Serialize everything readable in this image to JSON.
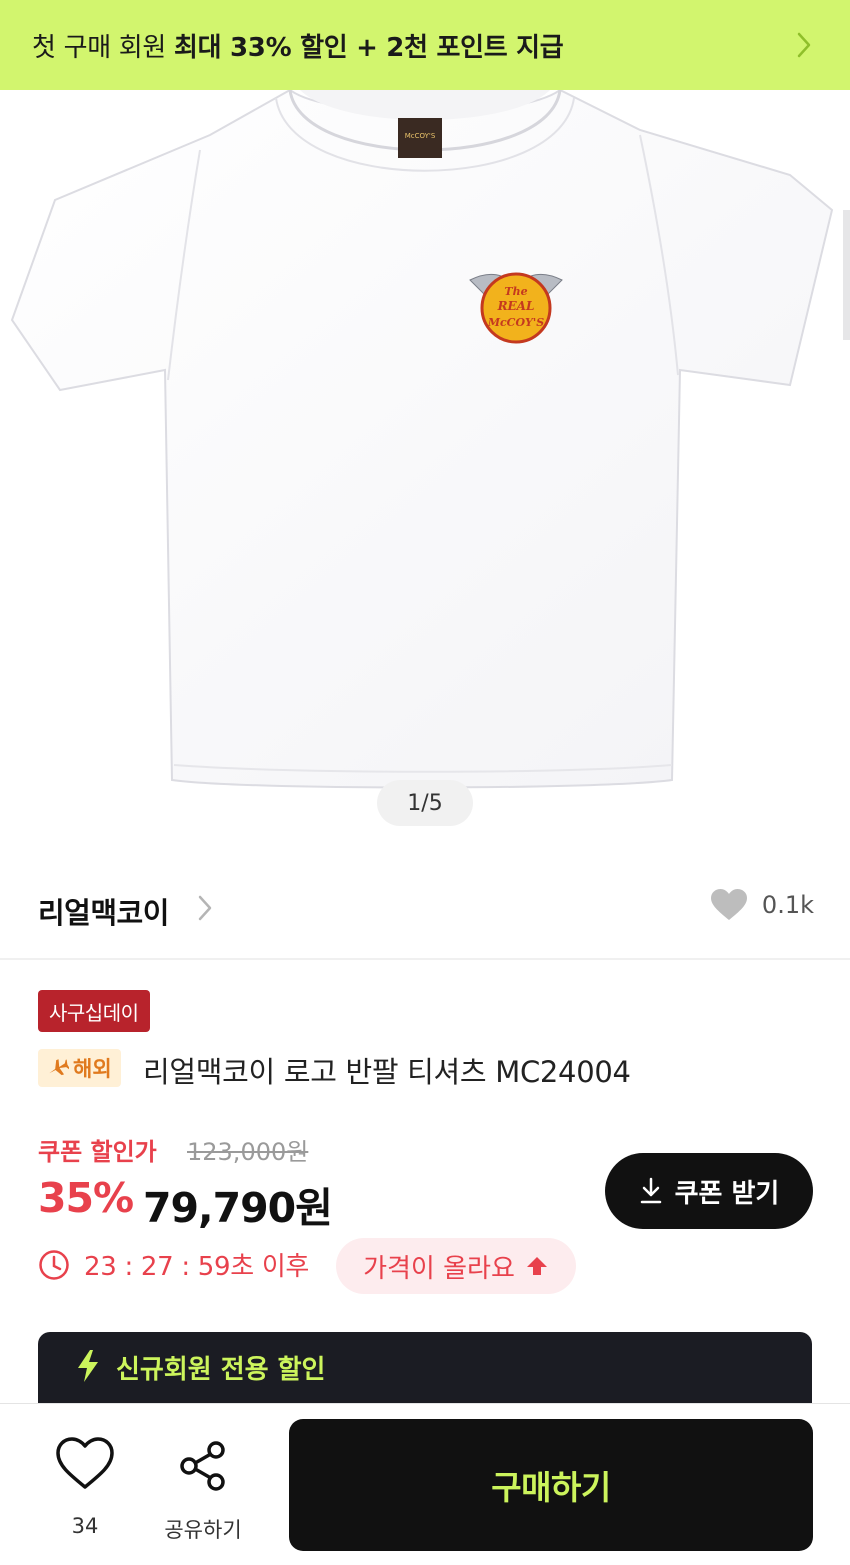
{
  "promo_banner": {
    "text_regular": "첫 구매 회원 ",
    "text_bold": "최대 33% 할인 + 2천 포인트 지급",
    "icon": "chevron-right-icon"
  },
  "gallery": {
    "pager_text": "1/5",
    "logo_line1": "The",
    "logo_line2": "REAL",
    "logo_line3": "McCOY'S",
    "tag_label": "McCOY'S"
  },
  "brand": {
    "name": "리얼맥코이",
    "like_count": "0.1k"
  },
  "product": {
    "event_badge": "사구십데이",
    "overseas_badge": "해외",
    "title": "리얼맥코이 로고 반팔 티셔츠 MC24004"
  },
  "pricing": {
    "coupon_label": "쿠폰 할인가",
    "original_price": "123,000원",
    "discount_rate": "35%",
    "sale_price": "79,790원",
    "coupon_button": "쿠폰 받기",
    "timer_text": "23 : 27 : 59초 이후",
    "price_up_text": "가격이 올라요"
  },
  "member_card": {
    "title": "신규회원 전용 할인"
  },
  "bottom_bar": {
    "wish_count": "34",
    "share_label": "공유하기",
    "buy_button": "구매하기"
  },
  "colors": {
    "promo_bg": "#d2f56e",
    "accent_red": "#e8414c",
    "event_badge_bg": "#b8232c",
    "dark": "#111111",
    "neon_green": "#ccf45c"
  }
}
